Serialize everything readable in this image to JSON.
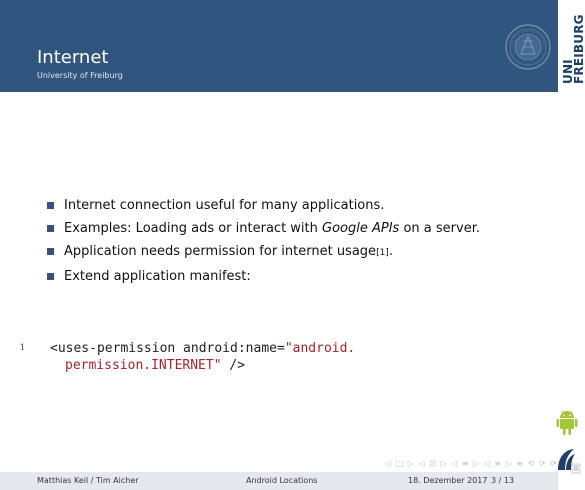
{
  "header": {
    "title": "Internet",
    "subtitle": "University of Freiburg"
  },
  "brand": {
    "text_line1": "UNI",
    "text_line2": "FREIBURG"
  },
  "bullets": {
    "item1": "Internet connection useful for many applications.",
    "item2_before": "Examples: Loading ads or interact with ",
    "item2_emph": "Google APIs",
    "item2_after": " on a server.",
    "item3_text": "Application needs permission for internet usage",
    "item3_ref": "[1]",
    "item3_end": ".",
    "item4": "Extend application manifest:"
  },
  "code": {
    "line_number": "1",
    "line1_tag": "<uses-permission android:name=",
    "line1_str": "\"android.",
    "line2_str": "permission.INTERNET\"",
    "line2_end": " />"
  },
  "nav": {
    "symbols": "◁ □ ▷ ◁ ⊡ ▷ ◁ ≡ ▷ ◁ ≡ ▷   ≡   ⟲ ⟳ ⟳"
  },
  "footer": {
    "authors": "Matthias Keil / Tim Aicher",
    "title": "Android Locations",
    "date": "18. Dezember 2017",
    "pages": "3 / 13"
  },
  "colors": {
    "header_bg": "#30567f",
    "bullet": "#30567f",
    "string": "#a8242f",
    "android": "#a4c639",
    "footer_bg": "#e5e8ec"
  },
  "icons": {
    "seal": "university-seal-icon",
    "android": "android-icon",
    "lab": "lab-logo-icon"
  }
}
